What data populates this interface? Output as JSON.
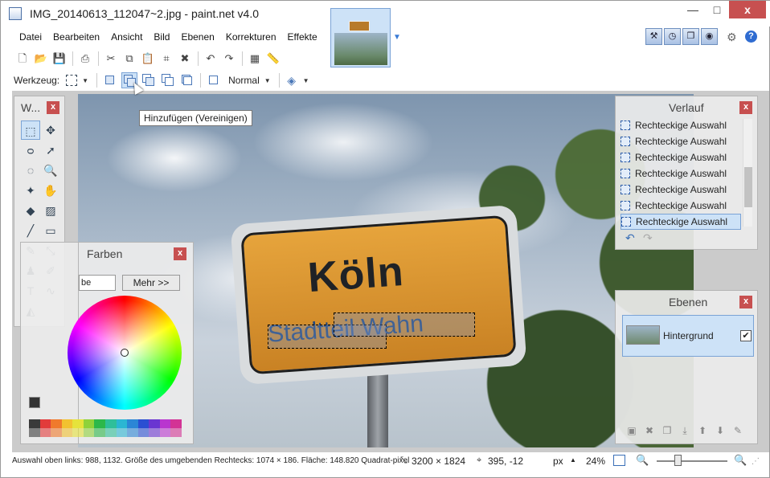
{
  "window": {
    "title": "IMG_20140613_112047~2.jpg - paint.net v4.0",
    "minimize": "—",
    "maximize": "□",
    "close": "x"
  },
  "menu": [
    "Datei",
    "Bearbeiten",
    "Ansicht",
    "Bild",
    "Ebenen",
    "Korrekturen",
    "Effekte"
  ],
  "toolbar2": {
    "tool_label": "Werkzeug:",
    "blend_mode": "Normal"
  },
  "tooltip": "Hinzufügen (Vereinigen)",
  "photo": {
    "sign_city": "Köln",
    "sign_sub": "Stadtteil Wahn"
  },
  "tools_panel": {
    "title": "W...",
    "close": "x",
    "tools": [
      {
        "name": "rectangle-select-icon",
        "glyph": "⬚"
      },
      {
        "name": "move-selected-icon",
        "glyph": "✥"
      },
      {
        "name": "lasso-select-icon",
        "glyph": "ᴑ"
      },
      {
        "name": "move-selection-icon",
        "glyph": "➚"
      },
      {
        "name": "ellipse-select-icon",
        "glyph": "◌"
      },
      {
        "name": "zoom-icon",
        "glyph": "🔍"
      },
      {
        "name": "magic-wand-icon",
        "glyph": "✦"
      },
      {
        "name": "pan-icon",
        "glyph": "✋"
      },
      {
        "name": "paint-bucket-icon",
        "glyph": "◆"
      },
      {
        "name": "gradient-icon",
        "glyph": "▨"
      },
      {
        "name": "paintbrush-icon",
        "glyph": "╱"
      },
      {
        "name": "eraser-icon",
        "glyph": "▭"
      },
      {
        "name": "pencil-icon",
        "glyph": "✎"
      },
      {
        "name": "color-picker-icon",
        "glyph": "⤡"
      },
      {
        "name": "clone-stamp-icon",
        "glyph": "♟"
      },
      {
        "name": "recolor-icon",
        "glyph": "✐"
      },
      {
        "name": "text-icon",
        "glyph": "T"
      },
      {
        "name": "line-curve-icon",
        "glyph": "∿"
      },
      {
        "name": "shapes-icon",
        "glyph": "◭"
      }
    ]
  },
  "colors_panel": {
    "title": "Farben",
    "close": "x",
    "mode_select": "be",
    "more_button": "Mehr >>",
    "palette": [
      "#3a3a3a",
      "#e23b3b",
      "#f07a2c",
      "#f2c230",
      "#e6e33b",
      "#8fd23a",
      "#2cb84a",
      "#2fbf9a",
      "#2bb6d3",
      "#2b86d6",
      "#2a4fd2",
      "#6a35d1",
      "#b935cf",
      "#d33395"
    ]
  },
  "history_panel": {
    "title": "Verlauf",
    "close": "x",
    "items": [
      "Rechteckige Auswahl",
      "Rechteckige Auswahl",
      "Rechteckige Auswahl",
      "Rechteckige Auswahl",
      "Rechteckige Auswahl",
      "Rechteckige Auswahl",
      "Rechteckige Auswahl"
    ],
    "selected_index": 6
  },
  "layers_panel": {
    "title": "Ebenen",
    "close": "x",
    "layer_name": "Hintergrund",
    "layer_visible": "✔"
  },
  "status": {
    "selection_info": "Auswahl oben links: 988, 1132. Größe des umgebenden Rechtecks: 1074 × 186. Fläche: 148.820 Quadrat-pixel",
    "image_size": "3200 × 1824",
    "cursor_pos": "395, -12",
    "unit": "px",
    "zoom": "24%"
  },
  "colors": {
    "accent": "#3a7bd5",
    "close_red": "#c75050",
    "selection_blue": "#cde2f7"
  }
}
